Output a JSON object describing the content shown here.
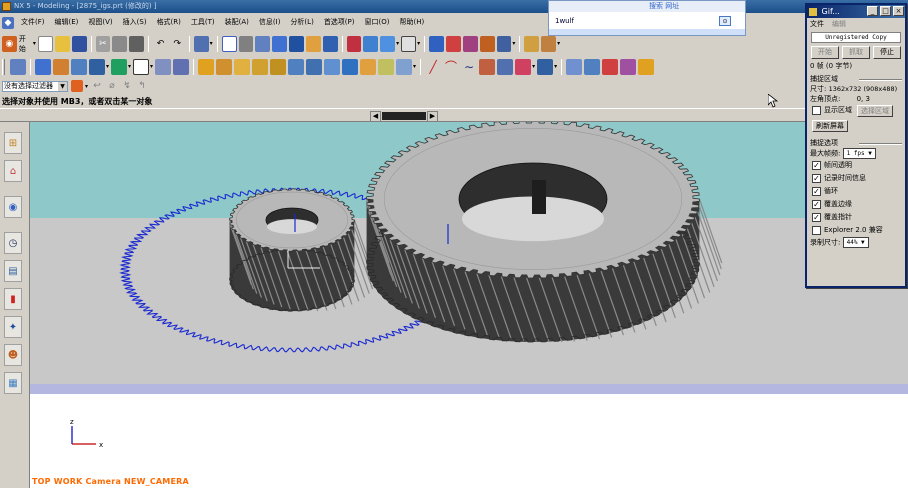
{
  "window": {
    "title": "NX 5 - Modeling - [2875_igs.prt  (修改的) ]"
  },
  "menu": [
    "文件(F)",
    "编辑(E)",
    "视图(V)",
    "插入(S)",
    "格式(R)",
    "工具(T)",
    "装配(A)",
    "信息(I)",
    "分析(L)",
    "首选项(P)",
    "窗口(O)",
    "帮助(H)"
  ],
  "toolbar": {
    "start_label": "开始"
  },
  "filter": {
    "value": "没有选择过滤器"
  },
  "status": {
    "prompt": "选择对象并使用 MB3，或者双击某一对象"
  },
  "viewport": {
    "camera_label": "TOP WORK Camera NEW_CAMERA",
    "triad_z": "z",
    "triad_x": "x",
    "colors": {
      "background_top": "#8ec8c8",
      "floor": "#c8c8c8",
      "gear_dark": "#3a3a3a",
      "gear_light": "#b8b8b8",
      "curve_blue": "#1a2ad0"
    }
  },
  "sogou": {
    "header": "搜索   网址",
    "input_value": "1wulf"
  },
  "gif_tool": {
    "title": "Gif...",
    "menu": [
      "文件",
      "编辑"
    ],
    "unregistered": "Unregistered Copy",
    "buttons": [
      "开始",
      "抓取",
      "停止"
    ],
    "frames": "0 帧 (0 字节)",
    "capture_section": "捕捉区域",
    "size_label": "尺寸:",
    "size_value": "1362x732 (908x488)",
    "corner_label": "左角顶点:",
    "corner_value": "0, 3",
    "show_area": "显示区域",
    "select_area": "选择区域",
    "refresh": "刷新屏幕",
    "options_section": "捕捉选项",
    "max_fps_label": "最大帧频:",
    "max_fps_value": "1 fps",
    "options": [
      {
        "label": "帧间透明",
        "checked": true
      },
      {
        "label": "记录时间信息",
        "checked": true
      },
      {
        "label": "循环",
        "checked": true
      },
      {
        "label": "覆盖边缘",
        "checked": true
      },
      {
        "label": "覆盖指针",
        "checked": true
      },
      {
        "label": "Explorer 2.0 兼容",
        "checked": false
      }
    ],
    "record_size_label": "录制尺寸:",
    "record_size_value": "44%"
  }
}
